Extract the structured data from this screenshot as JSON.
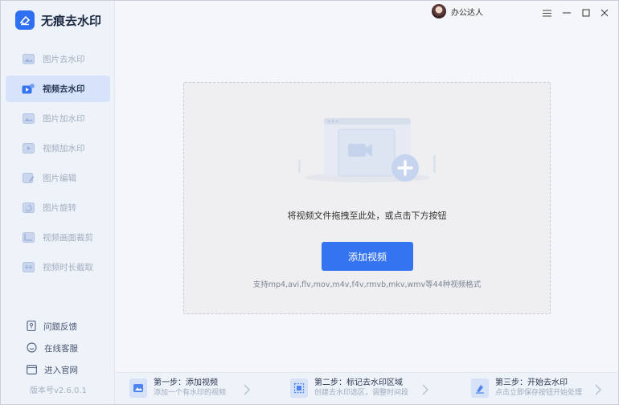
{
  "app": {
    "title": "无痕去水印",
    "version": "版本号v2.6.0.1"
  },
  "sidebar": {
    "items": [
      {
        "label": "图片去水印",
        "icon": "image-icon",
        "active": false
      },
      {
        "label": "视频去水印",
        "icon": "video-icon",
        "active": true
      },
      {
        "label": "图片加水印",
        "icon": "image-add-icon",
        "active": false
      },
      {
        "label": "视频加水印",
        "icon": "video-add-icon",
        "active": false
      },
      {
        "label": "图片编辑",
        "icon": "image-edit-icon",
        "active": false
      },
      {
        "label": "图片旋转",
        "icon": "image-rotate-icon",
        "active": false
      },
      {
        "label": "视频画面裁剪",
        "icon": "video-crop-icon",
        "active": false
      },
      {
        "label": "视频时长截取",
        "icon": "video-trim-icon",
        "active": false
      }
    ],
    "links": [
      {
        "label": "问题反馈",
        "icon": "feedback-icon"
      },
      {
        "label": "在线客服",
        "icon": "support-icon"
      },
      {
        "label": "进入官网",
        "icon": "website-icon"
      }
    ]
  },
  "titlebar": {
    "user_name": "办公达人"
  },
  "main": {
    "drop_hint": "将视频文件拖拽至此处，或点击下方按钮",
    "add_button": "添加视频",
    "formats": "支持mp4,avi,flv,mov,m4v,f4v,rmvb,mkv,wmv等44种视频格式"
  },
  "steps": [
    {
      "title": "第一步：添加视频",
      "desc": "添加一个有水印的视频"
    },
    {
      "title": "第二步：标记去水印区域",
      "desc": "创建去水印选区，调整时间段"
    },
    {
      "title": "第三步：开始去水印",
      "desc": "点击立即保存按钮开始处理"
    }
  ],
  "colors": {
    "accent": "#3574f0",
    "sidebar_bg": "#eef2f9",
    "active_bg": "#d6e3fa"
  }
}
